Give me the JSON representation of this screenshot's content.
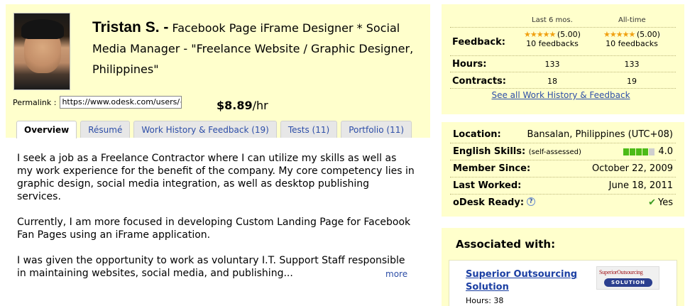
{
  "profile": {
    "name": "Tristan S. -",
    "headline": "Facebook Page iFrame Designer * Social Media Manager - \"Freelance Website / Graphic Designer, Philippines\"",
    "permalink_label": "Permalink :",
    "permalink_value": "https://www.odesk.com/users/~",
    "rate_amount": "$8.89",
    "rate_unit": "/hr"
  },
  "tabs": [
    {
      "label": "Overview",
      "active": true
    },
    {
      "label": "Résumé",
      "active": false
    },
    {
      "label": "Work History & Feedback (19)",
      "active": false
    },
    {
      "label": "Tests (11)",
      "active": false
    },
    {
      "label": "Portfolio (11)",
      "active": false
    }
  ],
  "overview": {
    "paragraphs": [
      "I seek a job as a Freelance Contractor where I can utilize my skills as well as my work experience for the benefit of the company. My core competency lies in graphic design, social media integration, as well as desktop publishing services.",
      "Currently, I am more focused in developing Custom Landing Page for Facebook Fan Pages using an iFrame application.",
      "I was given the opportunity to work as voluntary I.T. Support Staff responsible in maintaining websites, social media, and publishing..."
    ],
    "more_label": "more"
  },
  "feedback": {
    "col_recent": "Last 6 mos.",
    "col_alltime": "All-time",
    "feedback_label": "Feedback:",
    "recent_score": "(5.00)",
    "recent_count": "10 feedbacks",
    "alltime_score": "(5.00)",
    "alltime_count": "10 feedbacks",
    "star_rating": 5,
    "hours_label": "Hours:",
    "hours_recent": "133",
    "hours_alltime": "133",
    "contracts_label": "Contracts:",
    "contracts_recent": "18",
    "contracts_alltime": "19",
    "see_all": "See all Work History & Feedback"
  },
  "details": {
    "location_label": "Location:",
    "location_value": "Bansalan, Philippines (UTC+08)",
    "english_label": "English Skills:",
    "english_note": "(self-assessed)",
    "english_score": "4.0",
    "english_level": 4,
    "english_max": 5,
    "member_label": "Member Since:",
    "member_value": "October 22, 2009",
    "worked_label": "Last Worked:",
    "worked_value": "June 18, 2011",
    "ready_label": "oDesk Ready:",
    "help_icon": "?",
    "ready_value": "Yes"
  },
  "associated": {
    "title": "Associated with:",
    "company_name": "Superior Outsourcing Solution",
    "hours": "Hours: 38",
    "logo_top": "SuperiorOutsourcing",
    "logo_bottom": "SOLUTION"
  },
  "colors": {
    "panel_bg": "#ffffcc",
    "link": "#2d4ea7",
    "star": "#f0a010",
    "skill_green": "#4cbb17"
  }
}
